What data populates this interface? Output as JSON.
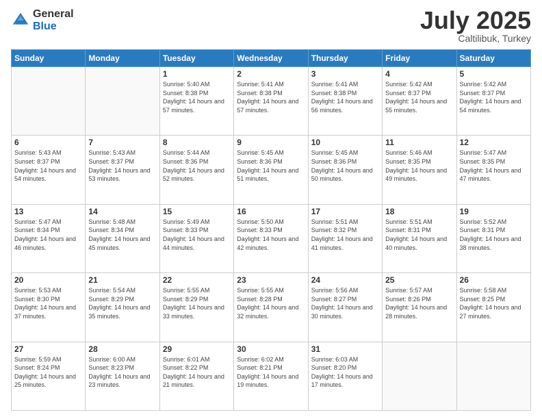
{
  "header": {
    "logo_general": "General",
    "logo_blue": "Blue",
    "month_title": "July 2025",
    "subtitle": "Caltilibuk, Turkey"
  },
  "weekdays": [
    "Sunday",
    "Monday",
    "Tuesday",
    "Wednesday",
    "Thursday",
    "Friday",
    "Saturday"
  ],
  "weeks": [
    [
      {
        "day": "",
        "sunrise": "",
        "sunset": "",
        "daylight": ""
      },
      {
        "day": "",
        "sunrise": "",
        "sunset": "",
        "daylight": ""
      },
      {
        "day": "1",
        "sunrise": "Sunrise: 5:40 AM",
        "sunset": "Sunset: 8:38 PM",
        "daylight": "Daylight: 14 hours and 57 minutes."
      },
      {
        "day": "2",
        "sunrise": "Sunrise: 5:41 AM",
        "sunset": "Sunset: 8:38 PM",
        "daylight": "Daylight: 14 hours and 57 minutes."
      },
      {
        "day": "3",
        "sunrise": "Sunrise: 5:41 AM",
        "sunset": "Sunset: 8:38 PM",
        "daylight": "Daylight: 14 hours and 56 minutes."
      },
      {
        "day": "4",
        "sunrise": "Sunrise: 5:42 AM",
        "sunset": "Sunset: 8:37 PM",
        "daylight": "Daylight: 14 hours and 55 minutes."
      },
      {
        "day": "5",
        "sunrise": "Sunrise: 5:42 AM",
        "sunset": "Sunset: 8:37 PM",
        "daylight": "Daylight: 14 hours and 54 minutes."
      }
    ],
    [
      {
        "day": "6",
        "sunrise": "Sunrise: 5:43 AM",
        "sunset": "Sunset: 8:37 PM",
        "daylight": "Daylight: 14 hours and 54 minutes."
      },
      {
        "day": "7",
        "sunrise": "Sunrise: 5:43 AM",
        "sunset": "Sunset: 8:37 PM",
        "daylight": "Daylight: 14 hours and 53 minutes."
      },
      {
        "day": "8",
        "sunrise": "Sunrise: 5:44 AM",
        "sunset": "Sunset: 8:36 PM",
        "daylight": "Daylight: 14 hours and 52 minutes."
      },
      {
        "day": "9",
        "sunrise": "Sunrise: 5:45 AM",
        "sunset": "Sunset: 8:36 PM",
        "daylight": "Daylight: 14 hours and 51 minutes."
      },
      {
        "day": "10",
        "sunrise": "Sunrise: 5:45 AM",
        "sunset": "Sunset: 8:36 PM",
        "daylight": "Daylight: 14 hours and 50 minutes."
      },
      {
        "day": "11",
        "sunrise": "Sunrise: 5:46 AM",
        "sunset": "Sunset: 8:35 PM",
        "daylight": "Daylight: 14 hours and 49 minutes."
      },
      {
        "day": "12",
        "sunrise": "Sunrise: 5:47 AM",
        "sunset": "Sunset: 8:35 PM",
        "daylight": "Daylight: 14 hours and 47 minutes."
      }
    ],
    [
      {
        "day": "13",
        "sunrise": "Sunrise: 5:47 AM",
        "sunset": "Sunset: 8:34 PM",
        "daylight": "Daylight: 14 hours and 46 minutes."
      },
      {
        "day": "14",
        "sunrise": "Sunrise: 5:48 AM",
        "sunset": "Sunset: 8:34 PM",
        "daylight": "Daylight: 14 hours and 45 minutes."
      },
      {
        "day": "15",
        "sunrise": "Sunrise: 5:49 AM",
        "sunset": "Sunset: 8:33 PM",
        "daylight": "Daylight: 14 hours and 44 minutes."
      },
      {
        "day": "16",
        "sunrise": "Sunrise: 5:50 AM",
        "sunset": "Sunset: 8:33 PM",
        "daylight": "Daylight: 14 hours and 42 minutes."
      },
      {
        "day": "17",
        "sunrise": "Sunrise: 5:51 AM",
        "sunset": "Sunset: 8:32 PM",
        "daylight": "Daylight: 14 hours and 41 minutes."
      },
      {
        "day": "18",
        "sunrise": "Sunrise: 5:51 AM",
        "sunset": "Sunset: 8:31 PM",
        "daylight": "Daylight: 14 hours and 40 minutes."
      },
      {
        "day": "19",
        "sunrise": "Sunrise: 5:52 AM",
        "sunset": "Sunset: 8:31 PM",
        "daylight": "Daylight: 14 hours and 38 minutes."
      }
    ],
    [
      {
        "day": "20",
        "sunrise": "Sunrise: 5:53 AM",
        "sunset": "Sunset: 8:30 PM",
        "daylight": "Daylight: 14 hours and 37 minutes."
      },
      {
        "day": "21",
        "sunrise": "Sunrise: 5:54 AM",
        "sunset": "Sunset: 8:29 PM",
        "daylight": "Daylight: 14 hours and 35 minutes."
      },
      {
        "day": "22",
        "sunrise": "Sunrise: 5:55 AM",
        "sunset": "Sunset: 8:29 PM",
        "daylight": "Daylight: 14 hours and 33 minutes."
      },
      {
        "day": "23",
        "sunrise": "Sunrise: 5:55 AM",
        "sunset": "Sunset: 8:28 PM",
        "daylight": "Daylight: 14 hours and 32 minutes."
      },
      {
        "day": "24",
        "sunrise": "Sunrise: 5:56 AM",
        "sunset": "Sunset: 8:27 PM",
        "daylight": "Daylight: 14 hours and 30 minutes."
      },
      {
        "day": "25",
        "sunrise": "Sunrise: 5:57 AM",
        "sunset": "Sunset: 8:26 PM",
        "daylight": "Daylight: 14 hours and 28 minutes."
      },
      {
        "day": "26",
        "sunrise": "Sunrise: 5:58 AM",
        "sunset": "Sunset: 8:25 PM",
        "daylight": "Daylight: 14 hours and 27 minutes."
      }
    ],
    [
      {
        "day": "27",
        "sunrise": "Sunrise: 5:59 AM",
        "sunset": "Sunset: 8:24 PM",
        "daylight": "Daylight: 14 hours and 25 minutes."
      },
      {
        "day": "28",
        "sunrise": "Sunrise: 6:00 AM",
        "sunset": "Sunset: 8:23 PM",
        "daylight": "Daylight: 14 hours and 23 minutes."
      },
      {
        "day": "29",
        "sunrise": "Sunrise: 6:01 AM",
        "sunset": "Sunset: 8:22 PM",
        "daylight": "Daylight: 14 hours and 21 minutes."
      },
      {
        "day": "30",
        "sunrise": "Sunrise: 6:02 AM",
        "sunset": "Sunset: 8:21 PM",
        "daylight": "Daylight: 14 hours and 19 minutes."
      },
      {
        "day": "31",
        "sunrise": "Sunrise: 6:03 AM",
        "sunset": "Sunset: 8:20 PM",
        "daylight": "Daylight: 14 hours and 17 minutes."
      },
      {
        "day": "",
        "sunrise": "",
        "sunset": "",
        "daylight": ""
      },
      {
        "day": "",
        "sunrise": "",
        "sunset": "",
        "daylight": ""
      }
    ]
  ]
}
